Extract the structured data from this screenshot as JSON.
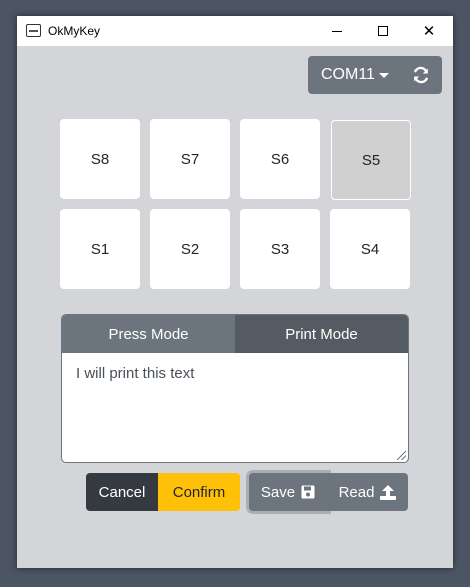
{
  "window": {
    "title": "OkMyKey"
  },
  "port": {
    "label": "COM11",
    "refresh_icon": "refresh-icon"
  },
  "keys": [
    "S8",
    "S7",
    "S6",
    "S5",
    "S1",
    "S2",
    "S3",
    "S4"
  ],
  "selected_key": "S5",
  "mode": {
    "tabs": [
      "Press Mode",
      "Print Mode"
    ],
    "active": "Print Mode",
    "text": "I will print this text"
  },
  "actions": {
    "cancel": "Cancel",
    "confirm": "Confirm",
    "save": "Save",
    "read": "Read",
    "save_icon": "save-icon",
    "read_icon": "upload-icon"
  },
  "colors": {
    "background": "#d4d5d9",
    "secondary": "#6c757d",
    "dark": "#343a40",
    "warning": "#ffc107"
  }
}
